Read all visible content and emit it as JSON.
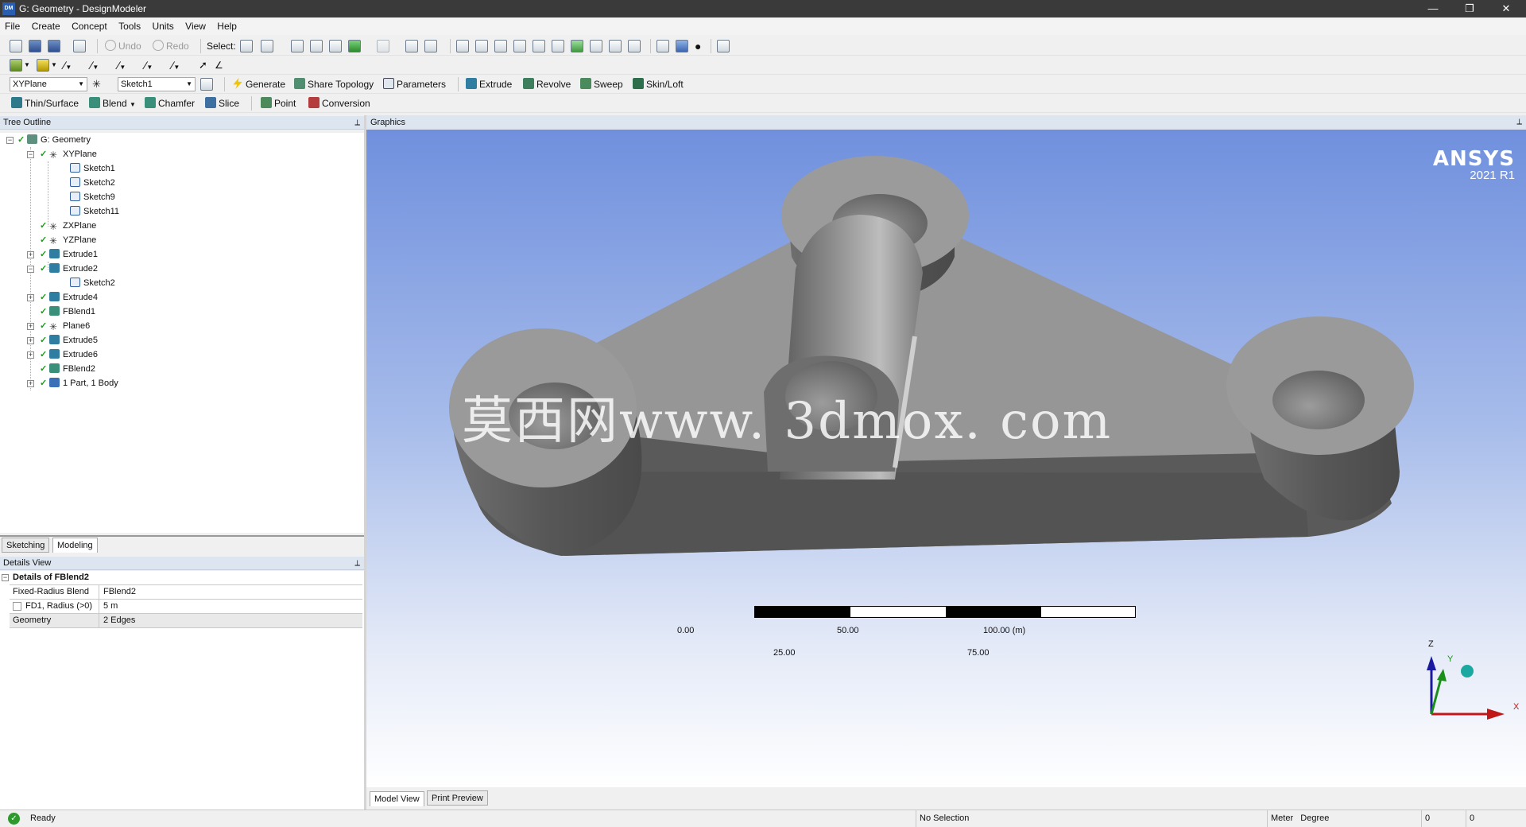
{
  "window": {
    "title": "G: Geometry - DesignModeler",
    "app_badge": "DM"
  },
  "menu": [
    "File",
    "Create",
    "Concept",
    "Tools",
    "Units",
    "View",
    "Help"
  ],
  "toolbar1": {
    "undo_label": "Undo",
    "redo_label": "Redo",
    "select_label": "Select:"
  },
  "toolbar3": {
    "plane_value": "XYPlane",
    "sketch_value": "Sketch1",
    "generate_label": "Generate",
    "share_topology_label": "Share Topology",
    "parameters_label": "Parameters",
    "extrude_label": "Extrude",
    "revolve_label": "Revolve",
    "sweep_label": "Sweep",
    "skinloft_label": "Skin/Loft"
  },
  "toolbar4": {
    "thin_surface_label": "Thin/Surface",
    "blend_label": "Blend",
    "chamfer_label": "Chamfer",
    "slice_label": "Slice",
    "point_label": "Point",
    "conversion_label": "Conversion"
  },
  "tree": {
    "title": "Tree Outline",
    "items": [
      {
        "label": "G: Geometry"
      },
      {
        "label": "XYPlane"
      },
      {
        "label": "Sketch1"
      },
      {
        "label": "Sketch2"
      },
      {
        "label": "Sketch9"
      },
      {
        "label": "Sketch11"
      },
      {
        "label": "ZXPlane"
      },
      {
        "label": "YZPlane"
      },
      {
        "label": "Extrude1"
      },
      {
        "label": "Extrude2"
      },
      {
        "label": "Sketch2"
      },
      {
        "label": "Extrude4"
      },
      {
        "label": "FBlend1"
      },
      {
        "label": "Plane6"
      },
      {
        "label": "Extrude5"
      },
      {
        "label": "Extrude6"
      },
      {
        "label": "FBlend2"
      },
      {
        "label": "1 Part, 1 Body"
      }
    ]
  },
  "tabs": {
    "sketching": "Sketching",
    "modeling": "Modeling"
  },
  "details": {
    "title": "Details View",
    "header": "Details of FBlend2",
    "rows": [
      {
        "key": "Fixed-Radius Blend",
        "value": "FBlend2"
      },
      {
        "key": "FD1, Radius (>0)",
        "value": "5 m"
      },
      {
        "key": "Geometry",
        "value": "2 Edges"
      }
    ]
  },
  "graphics": {
    "title": "Graphics",
    "brand": "ANSYS",
    "version": "2021 R1",
    "watermark": "莫西网www. 3dmox. com",
    "scale": {
      "t0": "0.00",
      "t50": "50.00",
      "t100": "100.00 (m)",
      "t25": "25.00",
      "t75": "75.00"
    },
    "axes": {
      "z": "Z",
      "y": "Y",
      "x": "X"
    }
  },
  "view_tabs": {
    "model_view": "Model View",
    "print_preview": "Print Preview"
  },
  "status": {
    "ready": "Ready",
    "selection": "No Selection",
    "units": "Meter   Degree",
    "c1": "0",
    "c2": "0"
  }
}
